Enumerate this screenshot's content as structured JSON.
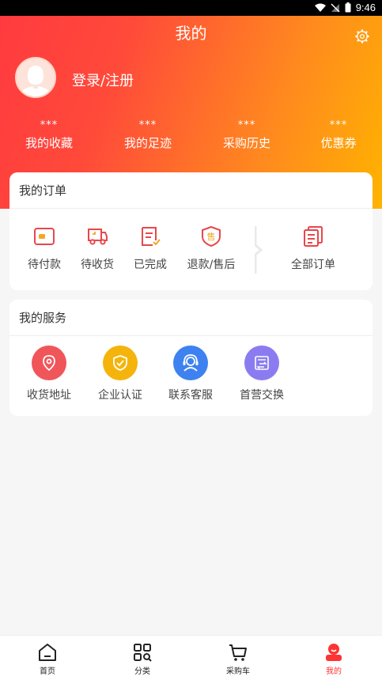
{
  "status_bar": {
    "time": "9:46"
  },
  "header": {
    "title": "我的",
    "login_label": "登录/注册"
  },
  "stats": [
    {
      "value": "***",
      "label": "我的收藏"
    },
    {
      "value": "***",
      "label": "我的足迹"
    },
    {
      "value": "***",
      "label": "采购历史"
    },
    {
      "value": "***",
      "label": "优惠券"
    }
  ],
  "orders": {
    "title": "我的订单",
    "items": [
      {
        "label": "待付款",
        "icon": "wallet-icon"
      },
      {
        "label": "待收货",
        "icon": "truck-icon"
      },
      {
        "label": "已完成",
        "icon": "checklist-icon"
      },
      {
        "label": "退款/售后",
        "icon": "shield-icon"
      }
    ],
    "all_label": "全部订单"
  },
  "services": {
    "title": "我的服务",
    "items": [
      {
        "label": "收货地址",
        "icon": "location-pin-icon",
        "color": "#f0555a"
      },
      {
        "label": "企业认证",
        "icon": "shield-check-icon",
        "color": "#f5b40c"
      },
      {
        "label": "联系客服",
        "icon": "headset-icon",
        "color": "#3d82f0"
      },
      {
        "label": "首营交换",
        "icon": "exchange-icon",
        "color": "#8a7cf0"
      }
    ]
  },
  "tabs": [
    {
      "label": "首页",
      "icon": "home-icon"
    },
    {
      "label": "分类",
      "icon": "category-icon"
    },
    {
      "label": "采购车",
      "icon": "cart-icon"
    },
    {
      "label": "我的",
      "icon": "profile-icon",
      "active": true
    }
  ],
  "colors": {
    "accent": "#ff3a3f",
    "gradient_end": "#ffb300",
    "active_tab": "#ff3333"
  }
}
